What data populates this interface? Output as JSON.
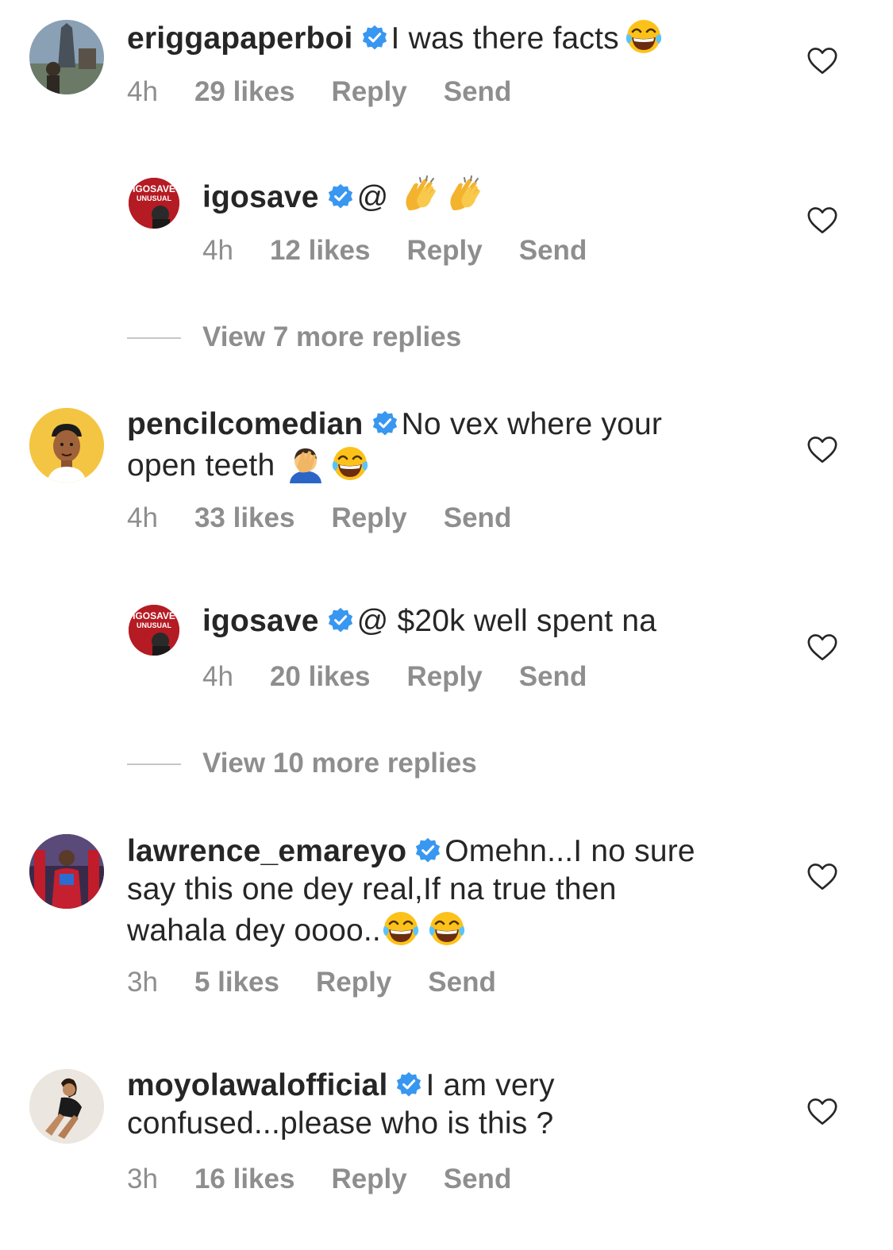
{
  "colors": {
    "text": "#262626",
    "secondary": "#8e8e8e",
    "verified": "#3897f0",
    "divider": "#c7c7c7"
  },
  "icons": {
    "verified": "verified-badge-icon",
    "like": "heart-outline-icon",
    "laugh": "face-with-tears-of-joy-emoji",
    "clap": "clapping-hands-emoji",
    "facepalm": "person-facepalming-emoji"
  },
  "comments": [
    {
      "username": "eriggapaperboi",
      "text": "I was there facts",
      "time": "4h",
      "likes": "29 likes",
      "reply": "Reply",
      "send": "Send"
    },
    {
      "username": "igosave",
      "text": "@",
      "time": "4h",
      "likes": "12 likes",
      "reply": "Reply",
      "send": "Send"
    },
    {
      "view_more": "View 7 more replies"
    },
    {
      "username": "pencilcomedian",
      "text_line1": "No vex where your",
      "text_line2": "open teeth",
      "time": "4h",
      "likes": "33 likes",
      "reply": "Reply",
      "send": "Send"
    },
    {
      "username": "igosave",
      "text": "@ $20k well spent na",
      "time": "4h",
      "likes": "20 likes",
      "reply": "Reply",
      "send": "Send"
    },
    {
      "view_more": "View 10 more replies"
    },
    {
      "username": "lawrence_emareyo",
      "text_line1": "Omehn...I no sure",
      "text_line2": "say this one dey real,If na true then",
      "text_line3": "wahala dey oooo..",
      "time": "3h",
      "likes": "5 likes",
      "reply": "Reply",
      "send": "Send"
    },
    {
      "username": "moyolawalofficial",
      "text_line1": "I am very",
      "text_line2": "confused...please who is this ?",
      "time": "3h",
      "likes": "16 likes",
      "reply": "Reply",
      "send": "Send"
    }
  ],
  "avatar_badges": {
    "igosave_line1": "IGOSAVE",
    "igosave_line2": "UNUSUAL"
  }
}
